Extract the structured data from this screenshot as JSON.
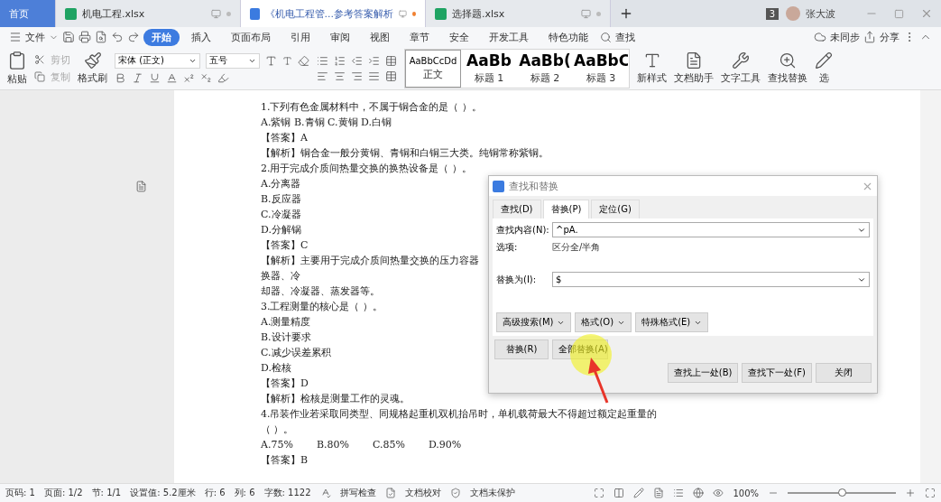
{
  "tabs": [
    {
      "label": "首页",
      "kind": "home",
      "selected": false
    },
    {
      "label": "机电工程.xlsx",
      "kind": "sheet",
      "selected": false
    },
    {
      "label": "《机电工程管...参考答案解析",
      "kind": "doc",
      "selected": true
    },
    {
      "label": "选择题.xlsx",
      "kind": "sheet",
      "selected": false
    }
  ],
  "user": {
    "badge": "3",
    "name": "张大波"
  },
  "menu": {
    "file": "文件",
    "items": [
      {
        "label": "开始",
        "selected": true
      },
      {
        "label": "插入",
        "selected": false
      },
      {
        "label": "页面布局",
        "selected": false
      },
      {
        "label": "引用",
        "selected": false
      },
      {
        "label": "审阅",
        "selected": false
      },
      {
        "label": "视图",
        "selected": false
      },
      {
        "label": "章节",
        "selected": false
      },
      {
        "label": "安全",
        "selected": false
      },
      {
        "label": "开发工具",
        "selected": false
      },
      {
        "label": "特色功能",
        "selected": false
      }
    ],
    "search": "查找",
    "sync": "未同步",
    "share": "分享"
  },
  "ribbon": {
    "paste": "粘贴",
    "cut": "剪切",
    "copy": "复制",
    "format_painter": "格式刷",
    "font": "宋体 (正文)",
    "size": "五号",
    "styles": [
      {
        "preview": "AaBbCcDd",
        "label": "正文",
        "selected": true
      },
      {
        "preview": "AaBb",
        "label": "标题 1",
        "selected": false
      },
      {
        "preview": "AaBb(",
        "label": "标题 2",
        "selected": false
      },
      {
        "preview": "AaBbC",
        "label": "标题 3",
        "selected": false
      }
    ],
    "tools": [
      "新样式",
      "文档助手",
      "文字工具",
      "查找替换",
      "选"
    ]
  },
  "document": [
    {
      "kind": "text",
      "text": "1.下列有色金属材料中，不属于铜合金的是（ ）。"
    },
    {
      "kind": "text",
      "text": "A.紫铜 B.青铜 C.黄铜 D.白铜"
    },
    {
      "kind": "text",
      "text": "【答案】A"
    },
    {
      "kind": "text",
      "text": "【解析】铜合金一般分黄铜、青铜和白铜三大类。纯铜常称紫铜。"
    },
    {
      "kind": "text",
      "text": "2.用于完成介质间热量交换的换热设备是（ ）。"
    },
    {
      "kind": "text",
      "text": "A.分离器"
    },
    {
      "kind": "text",
      "text": "B.反应器"
    },
    {
      "kind": "text",
      "text": "C.冷凝器"
    },
    {
      "kind": "text",
      "text": "D.分解锅"
    },
    {
      "kind": "text",
      "text": "【答案】C"
    },
    {
      "kind": "text",
      "text": "【解析】主要用于完成介质间热量交换的压力容器"
    },
    {
      "kind": "text",
      "text": "换器、冷"
    },
    {
      "kind": "text",
      "text": "却器、冷凝器、蒸发器等。"
    },
    {
      "kind": "text",
      "text": "3.工程测量的核心是（ ）。"
    },
    {
      "kind": "text",
      "text": "A.测量精度"
    },
    {
      "kind": "text",
      "text": "B.设计要求"
    },
    {
      "kind": "text",
      "text": "C.减少误差累积"
    },
    {
      "kind": "text",
      "text": "D.检核"
    },
    {
      "kind": "text",
      "text": "【答案】D"
    },
    {
      "kind": "text",
      "text": "【解析】检核是测量工作的灵魂。"
    },
    {
      "kind": "text",
      "text": "4.吊装作业若采取同类型、同规格起重机双机抬吊时，单机载荷最大不得超过额定起重量的"
    },
    {
      "kind": "text",
      "text": "（ ）。"
    },
    {
      "kind": "options",
      "items": [
        "A.75%",
        "B.80%",
        "C.85%",
        "D.90%"
      ]
    },
    {
      "kind": "text",
      "text": "【答案】B"
    }
  ],
  "dialog": {
    "title": "查找和替换",
    "tabs": [
      {
        "label": "查找(D)",
        "selected": false
      },
      {
        "label": "替换(P)",
        "selected": true
      },
      {
        "label": "定位(G)",
        "selected": false
      }
    ],
    "find_label": "查找内容(N):",
    "find_value": "^pA.",
    "options_label": "选项:",
    "options_value": "区分全/半角",
    "replace_label": "替换为(I):",
    "replace_value": "$",
    "menu_buttons": [
      "高级搜索(M)",
      "格式(O)",
      "特殊格式(E)"
    ],
    "replace": "替换(R)",
    "replace_all": "全部替换(A)",
    "prev": "查找上一处(B)",
    "next": "查找下一处(F)",
    "close": "关闭"
  },
  "status": {
    "items": [
      "页码: 1",
      "页面: 1/2",
      "节: 1/1",
      "设置值: 5.2厘米",
      "行: 6",
      "列: 6",
      "字数: 1122"
    ],
    "spell": "拼写检查",
    "proof": "文档校对",
    "protect": "文档未保护",
    "zoom": "100%",
    "zoom_slider": {
      "level": 0.5
    }
  }
}
